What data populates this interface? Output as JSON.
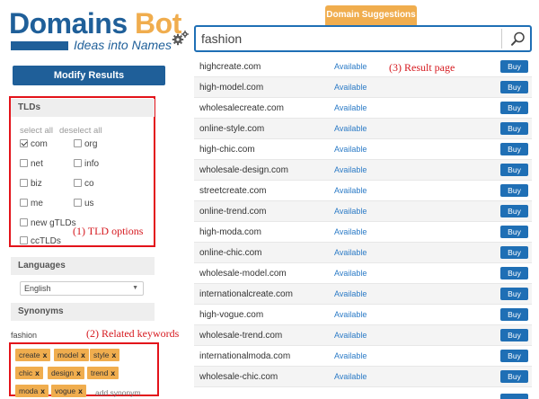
{
  "logo": {
    "word1": "Domains",
    "word2": "Bot",
    "tagline": "Ideas into Names"
  },
  "tab_label": "Domain Suggestions",
  "search": {
    "value": "fashion"
  },
  "modify_label": "Modify Results",
  "tlds": {
    "header": "TLDs",
    "select_all": "select all",
    "deselect_all": "deselect all",
    "options": [
      {
        "label": "com",
        "checked": true
      },
      {
        "label": "org",
        "checked": false
      },
      {
        "label": "net",
        "checked": false
      },
      {
        "label": "info",
        "checked": false
      },
      {
        "label": "biz",
        "checked": false
      },
      {
        "label": "co",
        "checked": false
      },
      {
        "label": "me",
        "checked": false
      },
      {
        "label": "us",
        "checked": false
      },
      {
        "label": "new gTLDs",
        "checked": false
      },
      {
        "label": "ccTLDs",
        "checked": false
      }
    ]
  },
  "annotations": {
    "tld": "(1) TLD options",
    "keywords": "(2) Related keywords",
    "results": "(3) Result page"
  },
  "languages": {
    "header": "Languages",
    "selected": "English"
  },
  "synonyms": {
    "header": "Synonyms",
    "word": "fashion",
    "keywords": [
      "create",
      "model",
      "style",
      "chic",
      "design",
      "trend",
      "moda",
      "vogue"
    ],
    "remove_mark": "x",
    "add_label": "add synonym"
  },
  "results": {
    "status_label": "Available",
    "buy_label": "Buy",
    "domains": [
      "highcreate.com",
      "high-model.com",
      "wholesalecreate.com",
      "online-style.com",
      "high-chic.com",
      "wholesale-design.com",
      "streetcreate.com",
      "online-trend.com",
      "high-moda.com",
      "online-chic.com",
      "wholesale-model.com",
      "internationalcreate.com",
      "high-vogue.com",
      "wholesale-trend.com",
      "internationalmoda.com",
      "wholesale-chic.com"
    ]
  },
  "colors": {
    "brand_blue": "#1f5f99",
    "accent_orange": "#f0ad4e",
    "annotation_red": "#e3131a"
  }
}
